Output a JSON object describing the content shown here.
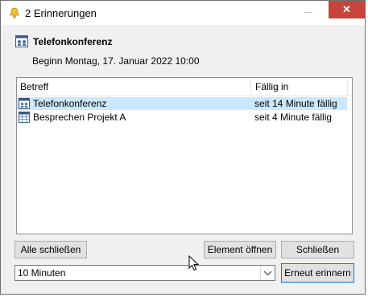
{
  "window": {
    "title": "2 Erinnerungen",
    "minimize_glyph": "",
    "close_glyph": "✕"
  },
  "reminder": {
    "subject": "Telefonkonferenz",
    "start": "Beginn Montag, 17. Januar 2022 10:00"
  },
  "list": {
    "columns": {
      "subject": "Betreff",
      "due": "Fällig in"
    },
    "rows": [
      {
        "subject": "Telefonkonferenz",
        "due": "seit 14 Minute fällig",
        "icon": "meeting-icon",
        "selected": true
      },
      {
        "subject": "Besprechen Projekt A",
        "due": "seit 4 Minute fällig",
        "icon": "calendar-icon",
        "selected": false
      }
    ]
  },
  "buttons": {
    "dismiss_all": "Alle schließen",
    "open_item": "Element öffnen",
    "dismiss": "Schließen",
    "snooze": "Erneut erinnern"
  },
  "snooze": {
    "selected": "10 Minuten"
  },
  "colors": {
    "selection": "#cce8ff",
    "close_red": "#c7443a",
    "accent_blue": "#0078d7"
  }
}
